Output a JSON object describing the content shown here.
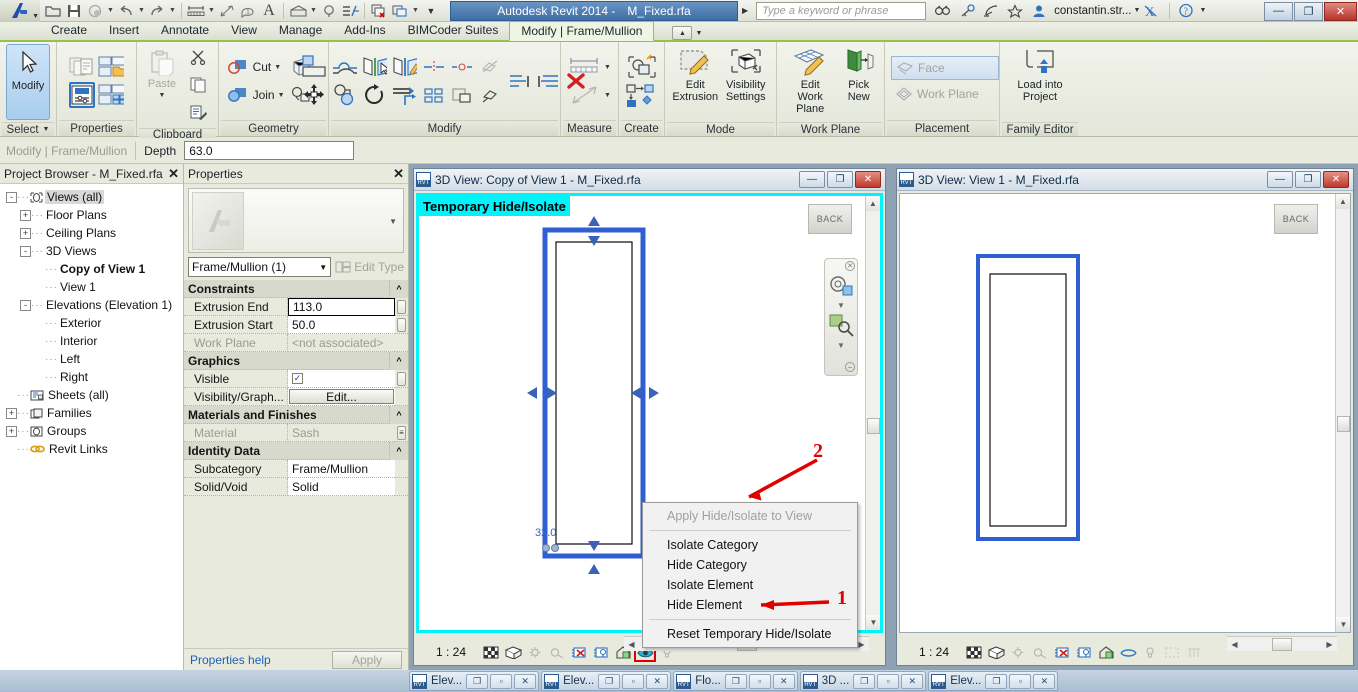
{
  "titlebar": {
    "app_title_prefix": "Autodesk Revit 2014 -",
    "document": "M_Fixed.rfa",
    "search_placeholder": "Type a keyword or phrase",
    "user": "constantin.str...",
    "qat": [
      {
        "name": "open-icon",
        "glyph": "open"
      },
      {
        "name": "save-icon",
        "glyph": "save"
      },
      {
        "name": "sync-with-central-icon",
        "glyph": "sync"
      },
      {
        "name": "undo-icon",
        "glyph": "undo"
      },
      {
        "name": "redo-icon",
        "glyph": "redo"
      },
      {
        "name": "measure-icon",
        "glyph": "measure"
      },
      {
        "name": "aligned-dimension-icon",
        "glyph": "dim"
      },
      {
        "name": "tag-icon",
        "glyph": "tag"
      },
      {
        "name": "text-icon",
        "glyph": "A"
      },
      {
        "name": "default-3d-view-icon",
        "glyph": "house"
      },
      {
        "name": "section-icon",
        "glyph": "section"
      },
      {
        "name": "thin-lines-icon",
        "glyph": "thin"
      },
      {
        "name": "close-hidden-windows-icon",
        "glyph": "closewin"
      },
      {
        "name": "switch-windows-icon",
        "glyph": "switch"
      },
      {
        "name": "qat-customize-icon",
        "glyph": "down"
      }
    ],
    "window_buttons": {
      "minimize": "—",
      "restore": "❐",
      "close": "✕"
    }
  },
  "tabs": [
    {
      "label": "Create",
      "active": false
    },
    {
      "label": "Insert",
      "active": false
    },
    {
      "label": "Annotate",
      "active": false
    },
    {
      "label": "View",
      "active": false
    },
    {
      "label": "Manage",
      "active": false
    },
    {
      "label": "Add-Ins",
      "active": false
    },
    {
      "label": "BIMCoder Suites",
      "active": false
    },
    {
      "label": "Modify | Frame/Mullion",
      "active": true
    }
  ],
  "ribbon": {
    "panels": [
      {
        "title": "Select",
        "items": [
          {
            "label": "Modify",
            "name": "modify-button"
          }
        ]
      },
      {
        "title": "Properties",
        "items": [
          {
            "label": "Type Properties",
            "name": "type-properties-button"
          },
          {
            "label": "Properties",
            "name": "properties-button"
          },
          {
            "label": "Family Category and Parameters",
            "name": "family-category-button"
          },
          {
            "label": "Family Types",
            "name": "family-types-button"
          }
        ]
      },
      {
        "title": "Clipboard",
        "items": [
          {
            "label": "Paste",
            "name": "paste-button"
          },
          {
            "label": "Cut",
            "name": "cut-clipboard-button"
          },
          {
            "label": "Copy",
            "name": "copy-button"
          },
          {
            "label": "Match Type Properties",
            "name": "match-type-button"
          }
        ]
      },
      {
        "title": "Geometry",
        "items": [
          {
            "label": "Cut",
            "name": "cut-geometry-button"
          },
          {
            "label": "Join",
            "name": "join-geometry-button"
          }
        ]
      },
      {
        "title": "Modify",
        "items": [
          {
            "label": "Align",
            "name": "align-button"
          },
          {
            "label": "Offset",
            "name": "offset-button"
          },
          {
            "label": "Mirror - Pick Axis",
            "name": "mirror-pick-axis-button"
          },
          {
            "label": "Mirror - Draw Axis",
            "name": "mirror-draw-axis-button"
          },
          {
            "label": "Move",
            "name": "move-button"
          },
          {
            "label": "Copy",
            "name": "copy-modify-button"
          },
          {
            "label": "Rotate",
            "name": "rotate-button"
          },
          {
            "label": "Trim/Extend",
            "name": "trim-extend-button"
          },
          {
            "label": "Split Element",
            "name": "split-element-button"
          },
          {
            "label": "Array",
            "name": "array-button"
          },
          {
            "label": "Scale",
            "name": "scale-button"
          },
          {
            "label": "Pin",
            "name": "pin-button"
          },
          {
            "label": "Unpin",
            "name": "unpin-button"
          },
          {
            "label": "Delete",
            "name": "delete-button"
          }
        ]
      },
      {
        "title": "Measure",
        "items": [
          {
            "label": "Measure Between Two References",
            "name": "measure-between-button"
          },
          {
            "label": "Measure Along An Element",
            "name": "measure-along-button"
          }
        ]
      },
      {
        "title": "Create",
        "items": [
          {
            "label": "Create Similar",
            "name": "create-similar-button"
          },
          {
            "label": "Create Group",
            "name": "create-group-button"
          }
        ]
      },
      {
        "title": "Mode",
        "items": [
          {
            "label": "Edit\nExtrusion",
            "line1": "Edit",
            "line2": "Extrusion",
            "name": "edit-extrusion-button"
          },
          {
            "line1": "Visibility",
            "line2": "Settings",
            "name": "visibility-settings-button"
          }
        ]
      },
      {
        "title": "Work Plane",
        "items": [
          {
            "line1": "Edit",
            "line2": "Work Plane",
            "name": "edit-work-plane-button"
          },
          {
            "line1": "Pick",
            "line2": "New",
            "name": "pick-new-button"
          }
        ]
      },
      {
        "title": "Placement",
        "items": [
          {
            "label": "Face",
            "name": "face-button"
          },
          {
            "label": "Work Plane",
            "name": "work-plane-button"
          }
        ]
      },
      {
        "title": "Family Editor",
        "items": [
          {
            "line1": "Load into",
            "line2": "Project",
            "name": "load-into-project-button"
          }
        ]
      }
    ]
  },
  "options_bar": {
    "context_label": "Modify | Frame/Mullion",
    "depth_label": "Depth",
    "depth_value": "63.0"
  },
  "project_browser": {
    "title": "Project Browser - M_Fixed.rfa",
    "tree": [
      {
        "label": "Views (all)",
        "depth": 0,
        "expander": "-",
        "icon": "views-icon",
        "selected": true,
        "bold": false
      },
      {
        "label": "Floor Plans",
        "depth": 1,
        "expander": "+",
        "icon": "",
        "selected": false,
        "bold": false
      },
      {
        "label": "Ceiling Plans",
        "depth": 1,
        "expander": "+",
        "icon": "",
        "selected": false,
        "bold": false
      },
      {
        "label": "3D Views",
        "depth": 1,
        "expander": "-",
        "icon": "",
        "selected": false,
        "bold": false
      },
      {
        "label": "Copy of View 1",
        "depth": 2,
        "expander": "",
        "icon": "",
        "selected": false,
        "bold": true
      },
      {
        "label": "View 1",
        "depth": 2,
        "expander": "",
        "icon": "",
        "selected": false,
        "bold": false
      },
      {
        "label": "Elevations (Elevation 1)",
        "depth": 1,
        "expander": "-",
        "icon": "",
        "selected": false,
        "bold": false
      },
      {
        "label": "Exterior",
        "depth": 2,
        "expander": "",
        "icon": "",
        "selected": false,
        "bold": false
      },
      {
        "label": "Interior",
        "depth": 2,
        "expander": "",
        "icon": "",
        "selected": false,
        "bold": false
      },
      {
        "label": "Left",
        "depth": 2,
        "expander": "",
        "icon": "",
        "selected": false,
        "bold": false
      },
      {
        "label": "Right",
        "depth": 2,
        "expander": "",
        "icon": "",
        "selected": false,
        "bold": false
      },
      {
        "label": "Sheets (all)",
        "depth": 0,
        "expander": "",
        "icon": "sheets-icon",
        "selected": false,
        "bold": false
      },
      {
        "label": "Families",
        "depth": 0,
        "expander": "+",
        "icon": "families-icon",
        "selected": false,
        "bold": false
      },
      {
        "label": "Groups",
        "depth": 0,
        "expander": "+",
        "icon": "groups-icon",
        "selected": false,
        "bold": false
      },
      {
        "label": "Revit Links",
        "depth": 0,
        "expander": "",
        "icon": "links-icon",
        "selected": false,
        "bold": false
      }
    ]
  },
  "properties": {
    "title": "Properties",
    "type_selector": "Frame/Mullion (1)",
    "edit_type_label": "Edit Type",
    "help_label": "Properties help",
    "apply_label": "Apply",
    "groups": [
      {
        "name": "Constraints",
        "rows": [
          {
            "name": "Extrusion End",
            "value": "113.0",
            "kind": "active",
            "lock": true
          },
          {
            "name": "Extrusion Start",
            "value": "50.0",
            "kind": "text",
            "lock": true
          },
          {
            "name": "Work Plane",
            "value": "<not associated>",
            "kind": "greyed",
            "lock": false
          }
        ]
      },
      {
        "name": "Graphics",
        "rows": [
          {
            "name": "Visible",
            "value": "",
            "kind": "check",
            "lock": true
          },
          {
            "name": "Visibility/Graph...",
            "value": "Edit...",
            "kind": "button",
            "lock": false
          }
        ]
      },
      {
        "name": "Materials and Finishes",
        "rows": [
          {
            "name": "Material",
            "value": "Sash",
            "kind": "greyed",
            "lock": false,
            "browse": true
          }
        ]
      },
      {
        "name": "Identity Data",
        "rows": [
          {
            "name": "Subcategory",
            "value": "Frame/Mullion",
            "kind": "text",
            "lock": false
          },
          {
            "name": "Solid/Void",
            "value": "Solid",
            "kind": "text",
            "lock": false
          }
        ]
      }
    ]
  },
  "view_windows": [
    {
      "title": "3D View: Copy of View 1 - M_Fixed.rfa",
      "banner": "Temporary Hide/Isolate",
      "scale": "1 : 24",
      "dimension_label": "32.0",
      "navcube_label": "BACK",
      "buttons": {
        "minimize": "—",
        "restore": "❐",
        "close": "✕"
      }
    },
    {
      "title": "3D View: View 1 - M_Fixed.rfa",
      "banner": "",
      "scale": "1 : 24",
      "dimension_label": "",
      "navcube_label": "BACK",
      "buttons": {
        "minimize": "—",
        "restore": "❐",
        "close": "✕"
      }
    }
  ],
  "context_menu": {
    "items": [
      {
        "label": "Apply Hide/Isolate to View",
        "disabled": true,
        "underline_index": 0,
        "separator_after": true
      },
      {
        "label": "Isolate Category",
        "disabled": false,
        "underline_index": -1,
        "separator_after": false
      },
      {
        "label": "Hide Category",
        "disabled": false,
        "underline_index": -1,
        "separator_after": false
      },
      {
        "label": "Isolate Element",
        "disabled": false,
        "underline_index": 0,
        "separator_after": false
      },
      {
        "label": "Hide Element",
        "disabled": false,
        "underline_index": 0,
        "separator_after": true
      },
      {
        "label": "Reset Temporary Hide/Isolate",
        "disabled": false,
        "underline_index": -1,
        "separator_after": false
      }
    ]
  },
  "annotations": [
    {
      "label": "1",
      "target": "hide-element-menu-item"
    },
    {
      "label": "2",
      "target": "temporary-hide-isolate-view-button"
    }
  ],
  "taskbar": {
    "items": [
      {
        "label": "Elev...",
        "name": "task-elevation-1"
      },
      {
        "label": "Elev...",
        "name": "task-elevation-2"
      },
      {
        "label": "Flo...",
        "name": "task-floor-plan"
      },
      {
        "label": "3D ...",
        "name": "task-3d-view"
      },
      {
        "label": "Elev...",
        "name": "task-elevation-3"
      }
    ],
    "buttons": {
      "restore": "❐",
      "minimize": "▫",
      "close": "✕"
    }
  },
  "colors": {
    "ribbon_accent": "#93c34a",
    "title_blue": "#3d6ea6",
    "cyan_banner": "#00f2fb",
    "annotation_red": "#e00000",
    "select_blue": "#2f74c0",
    "model_blue": "#2f5fd0"
  }
}
